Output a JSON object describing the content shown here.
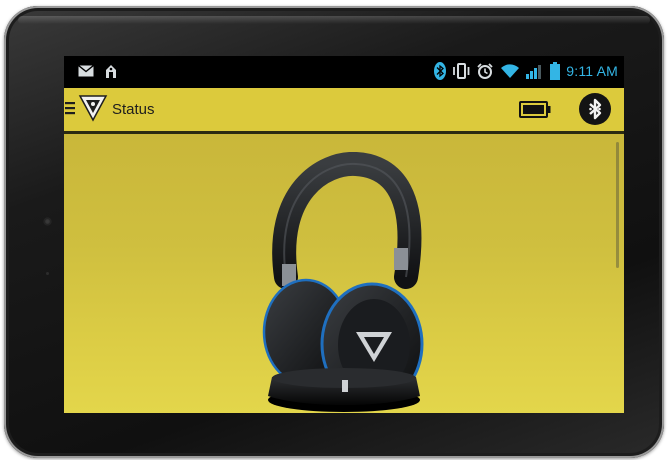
{
  "status_bar": {
    "time": "9:11 AM",
    "icons": [
      "mail-icon",
      "cast-icon",
      "bluetooth-icon",
      "vibrate-icon",
      "alarm-icon",
      "wifi-icon",
      "signal-icon",
      "battery-icon"
    ]
  },
  "app_bar": {
    "title": "Status",
    "icons": [
      "menu-icon",
      "brand-logo-icon",
      "headset-battery-icon",
      "bluetooth-button-icon"
    ]
  },
  "content": {
    "image": "headset-on-stand"
  },
  "colors": {
    "app_bar": "#dcca3c",
    "content_top": "#c9b73a",
    "content_bottom": "#e3d64b",
    "status_accent": "#33b5e5",
    "bezel": "#1a1a1a"
  }
}
